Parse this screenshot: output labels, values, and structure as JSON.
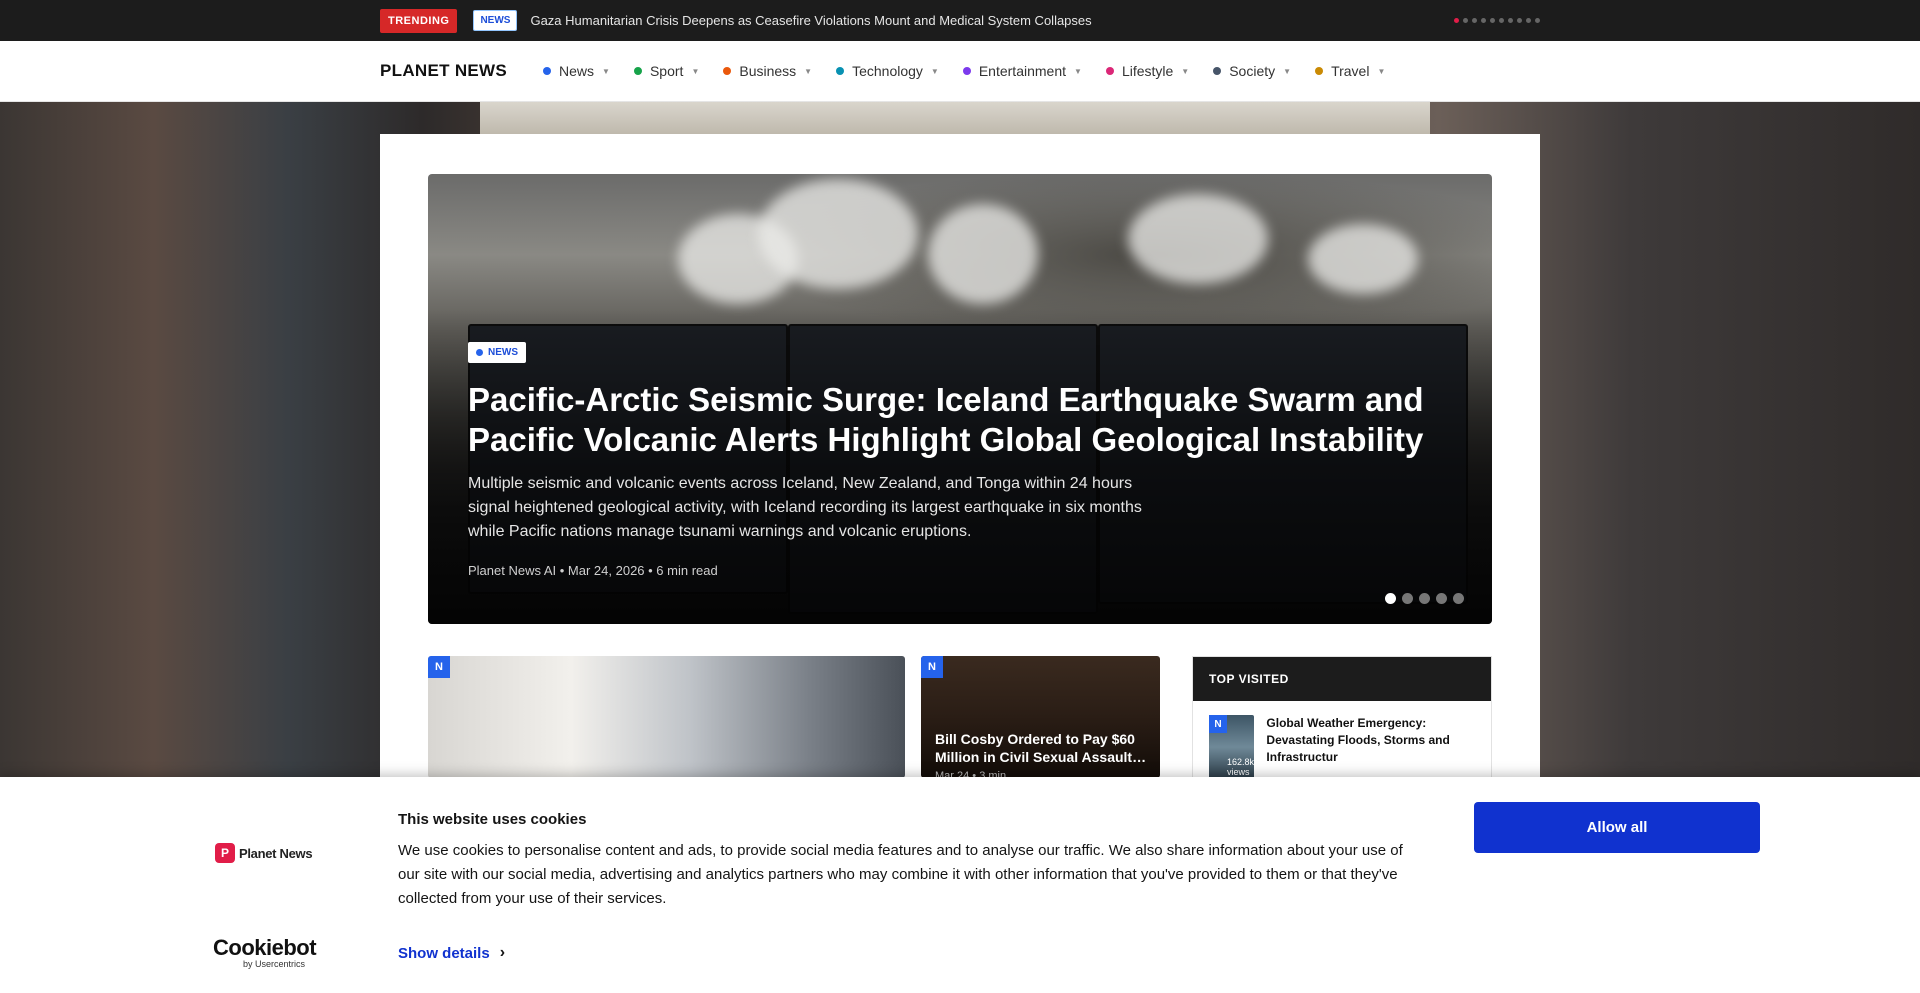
{
  "topbar": {
    "trending_label": "TRENDING",
    "category": "NEWS",
    "headline": "Gaza Humanitarian Crisis Deepens as Ceasefire Violations Mount and Medical System Collapses"
  },
  "nav": {
    "brand": "PLANET NEWS",
    "items": [
      {
        "label": "News",
        "color": "#2563eb"
      },
      {
        "label": "Sport",
        "color": "#16a34a"
      },
      {
        "label": "Business",
        "color": "#ea580c"
      },
      {
        "label": "Technology",
        "color": "#0891b2"
      },
      {
        "label": "Entertainment",
        "color": "#7c3aed"
      },
      {
        "label": "Lifestyle",
        "color": "#db2777"
      },
      {
        "label": "Society",
        "color": "#475569"
      },
      {
        "label": "Travel",
        "color": "#ca8a04"
      }
    ]
  },
  "hero": {
    "badge": "NEWS",
    "title": "Pacific-Arctic Seismic Surge: Iceland Earthquake Swarm and Pacific Volcanic Alerts Highlight Global Geological Instability",
    "summary": "Multiple seismic and volcanic events across Iceland, New Zealand, and Tonga within 24 hours signal heightened geological activity, with Iceland recording its largest earthquake in six months while Pacific nations manage tsunami warnings and volcanic eruptions.",
    "meta": "Planet News AI • Mar 24, 2026 • 6 min read"
  },
  "tiles": {
    "tile1_badge": "N",
    "tile2_badge": "N",
    "tile2_title": "Bill Cosby Ordered to Pay $60 Million in Civil Sexual Assault…",
    "tile2_meta": "Mar 24 • 3 min"
  },
  "top_visited": {
    "heading": "TOP VISITED",
    "item_badge": "N",
    "item_title": "Global Weather Emergency: Devastating Floods, Storms and Infrastructur",
    "item_views": "162.8k views"
  },
  "cookie": {
    "logo_text": "Planet News",
    "title": "This website uses cookies",
    "body": "We use cookies to personalise content and ads, to provide social media features and to analyse our traffic. We also share information about your use of our site with our social media, advertising and analytics partners who may combine it with other information that you've provided to them or that they've collected from your use of their services.",
    "details_label": "Show details",
    "allow_label": "Allow all",
    "cookiebot_big": "Cookiebot",
    "cookiebot_small": "by Usercentrics"
  }
}
